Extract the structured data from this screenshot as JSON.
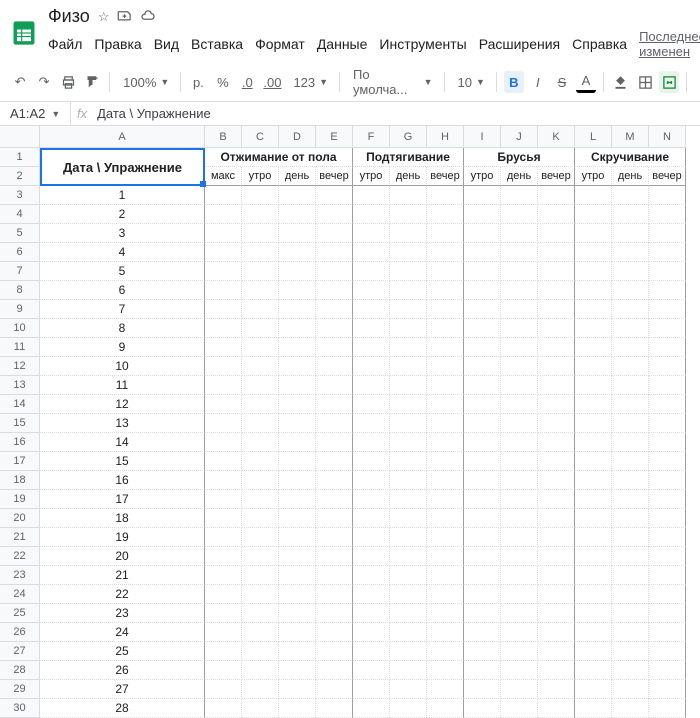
{
  "doc": {
    "title": "Физо"
  },
  "menu": [
    "Файл",
    "Правка",
    "Вид",
    "Вставка",
    "Формат",
    "Данные",
    "Инструменты",
    "Расширения",
    "Справка"
  ],
  "last_edit": "Последнее изменен",
  "toolbar": {
    "zoom": "100%",
    "currency": "р.",
    "percent": "%",
    "dec_dec": ".0",
    "dec_inc": ".00",
    "format123": "123",
    "font": "По умолча...",
    "font_size": "10",
    "bold": "B",
    "italic": "I",
    "strike": "S",
    "text_color": "A"
  },
  "name_box": "A1:A2",
  "formula": "Дата \\ Упражнение",
  "columns": [
    "A",
    "B",
    "C",
    "D",
    "E",
    "F",
    "G",
    "H",
    "I",
    "J",
    "K",
    "L",
    "M",
    "N"
  ],
  "row_count": 30,
  "merged_header": "Дата \\ Упражнение",
  "groups": [
    {
      "label": "Отжимание от пола",
      "span": 4,
      "subs": [
        "макс",
        "утро",
        "день",
        "вечер"
      ]
    },
    {
      "label": "Подтягивание",
      "span": 3,
      "subs": [
        "утро",
        "день",
        "вечер"
      ]
    },
    {
      "label": "Брусья",
      "span": 3,
      "subs": [
        "утро",
        "день",
        "вечер"
      ]
    },
    {
      "label": "Скручивание",
      "span": 3,
      "subs": [
        "утро",
        "день",
        "вечер"
      ]
    }
  ],
  "data_col_a": [
    1,
    2,
    3,
    4,
    5,
    6,
    7,
    8,
    9,
    10,
    11,
    12,
    13,
    14,
    15,
    16,
    17,
    18,
    19,
    20,
    21,
    22,
    23,
    24,
    25,
    26,
    27,
    28
  ]
}
